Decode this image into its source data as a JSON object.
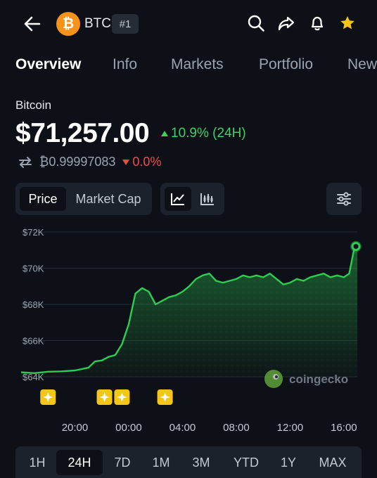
{
  "header": {
    "ticker": "BTC",
    "rank": "#1",
    "coin_logo_glyph": "₿",
    "icons": [
      "back-arrow-icon",
      "search-icon",
      "share-icon",
      "bell-icon",
      "star-icon"
    ]
  },
  "tabs": [
    {
      "label": "Overview",
      "active": true
    },
    {
      "label": "Info",
      "active": false
    },
    {
      "label": "Markets",
      "active": false
    },
    {
      "label": "Portfolio",
      "active": false
    },
    {
      "label": "News",
      "active": false
    }
  ],
  "coin": {
    "name": "Bitcoin",
    "price": "$71,257.00",
    "change_24h": "10.9% (24H)",
    "btc_price": "₿0.99997083",
    "btc_change": "0.0%"
  },
  "controls": {
    "chart_mode": [
      "Price",
      "Market Cap"
    ],
    "active_mode": "Price",
    "chart_type_icons": [
      "line-chart-icon",
      "candlestick-chart-icon"
    ],
    "active_chart_type": "line-chart-icon",
    "settings_icon": "sliders-icon"
  },
  "watermark": "coingecko",
  "colors": {
    "up": "#3fcf62",
    "down": "#ef4a4a",
    "accent_star": "#f5c518",
    "btc_orange": "#f7931a",
    "line": "#2ecc53"
  },
  "chart_data": {
    "type": "area",
    "y_tick_labels": [
      "$72K",
      "$70K",
      "$68K",
      "$66K",
      "$64K"
    ],
    "y_ticks": [
      72000,
      70000,
      68000,
      66000,
      64000
    ],
    "ylim": [
      64000,
      72000
    ],
    "x_tick_labels": [
      "20:00",
      "00:00",
      "04:00",
      "08:00",
      "12:00",
      "16:00"
    ],
    "x_ticks": [
      20,
      24,
      28,
      32,
      36,
      40
    ],
    "xlim": [
      16,
      41
    ],
    "grid": true,
    "event_markers_x": [
      18,
      22.2,
      23.5,
      26.7
    ],
    "x": [
      16,
      17,
      18,
      19,
      20,
      21,
      21.5,
      22,
      22.5,
      23,
      23.5,
      24,
      24.5,
      25,
      25.5,
      26,
      26.5,
      27,
      27.5,
      28,
      28.5,
      29,
      29.5,
      30,
      30.5,
      31,
      31.5,
      32,
      32.5,
      33,
      33.5,
      34,
      34.5,
      35,
      35.5,
      36,
      36.5,
      37,
      37.5,
      38,
      38.5,
      39,
      39.5,
      40,
      40.4,
      40.8,
      41
    ],
    "y": [
      64250,
      64200,
      64280,
      64300,
      64350,
      64500,
      64850,
      64900,
      65100,
      65200,
      65800,
      66900,
      68600,
      68900,
      68700,
      68000,
      68200,
      68400,
      68500,
      68700,
      69000,
      69400,
      69600,
      69700,
      69300,
      69200,
      69300,
      69400,
      69600,
      69500,
      69600,
      69500,
      69700,
      69400,
      69100,
      69200,
      69400,
      69300,
      69500,
      69600,
      69700,
      69500,
      69600,
      69500,
      69700,
      71200,
      71200
    ]
  },
  "ranges": [
    "1H",
    "24H",
    "7D",
    "1M",
    "3M",
    "YTD",
    "1Y",
    "MAX"
  ],
  "active_range": "24H"
}
